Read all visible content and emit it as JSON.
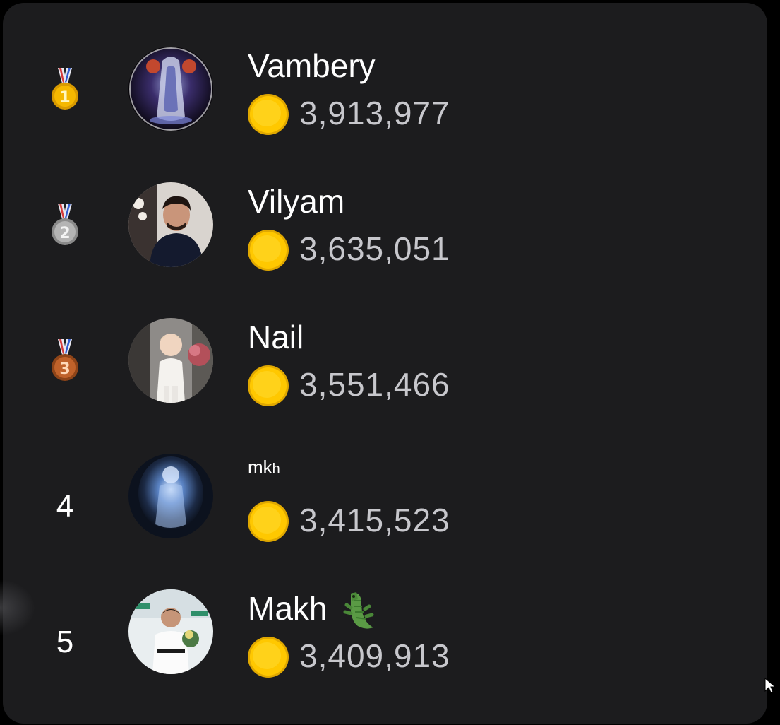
{
  "leaderboard": {
    "entries": [
      {
        "rank": "1",
        "medal": "gold-medal",
        "name": "Vambery",
        "score": "3,913,977",
        "medal_color": "#f5b800"
      },
      {
        "rank": "2",
        "medal": "silver-medal",
        "name": "Vilyam",
        "score": "3,635,051",
        "medal_color": "#a8a8a8"
      },
      {
        "rank": "3",
        "medal": "bronze-medal",
        "name": "Nail",
        "score": "3,551,466",
        "medal_color": "#c0622a"
      },
      {
        "rank": "4",
        "medal": null,
        "name": "mk",
        "name_suffix": "h",
        "score": "3,415,523"
      },
      {
        "rank": "5",
        "medal": null,
        "name": "Makh",
        "name_emoji": "crocodile-emoji",
        "score": "3,409,913"
      }
    ]
  },
  "colors": {
    "background": "#000000",
    "card": "#1c1c1e",
    "name_text": "#ffffff",
    "score_text": "#c7c7cc",
    "coin": "#ffc800"
  },
  "icons": {
    "coin": "coin-icon",
    "medals": [
      "gold-medal-icon",
      "silver-medal-icon",
      "bronze-medal-icon"
    ],
    "emoji": "crocodile-emoji"
  }
}
